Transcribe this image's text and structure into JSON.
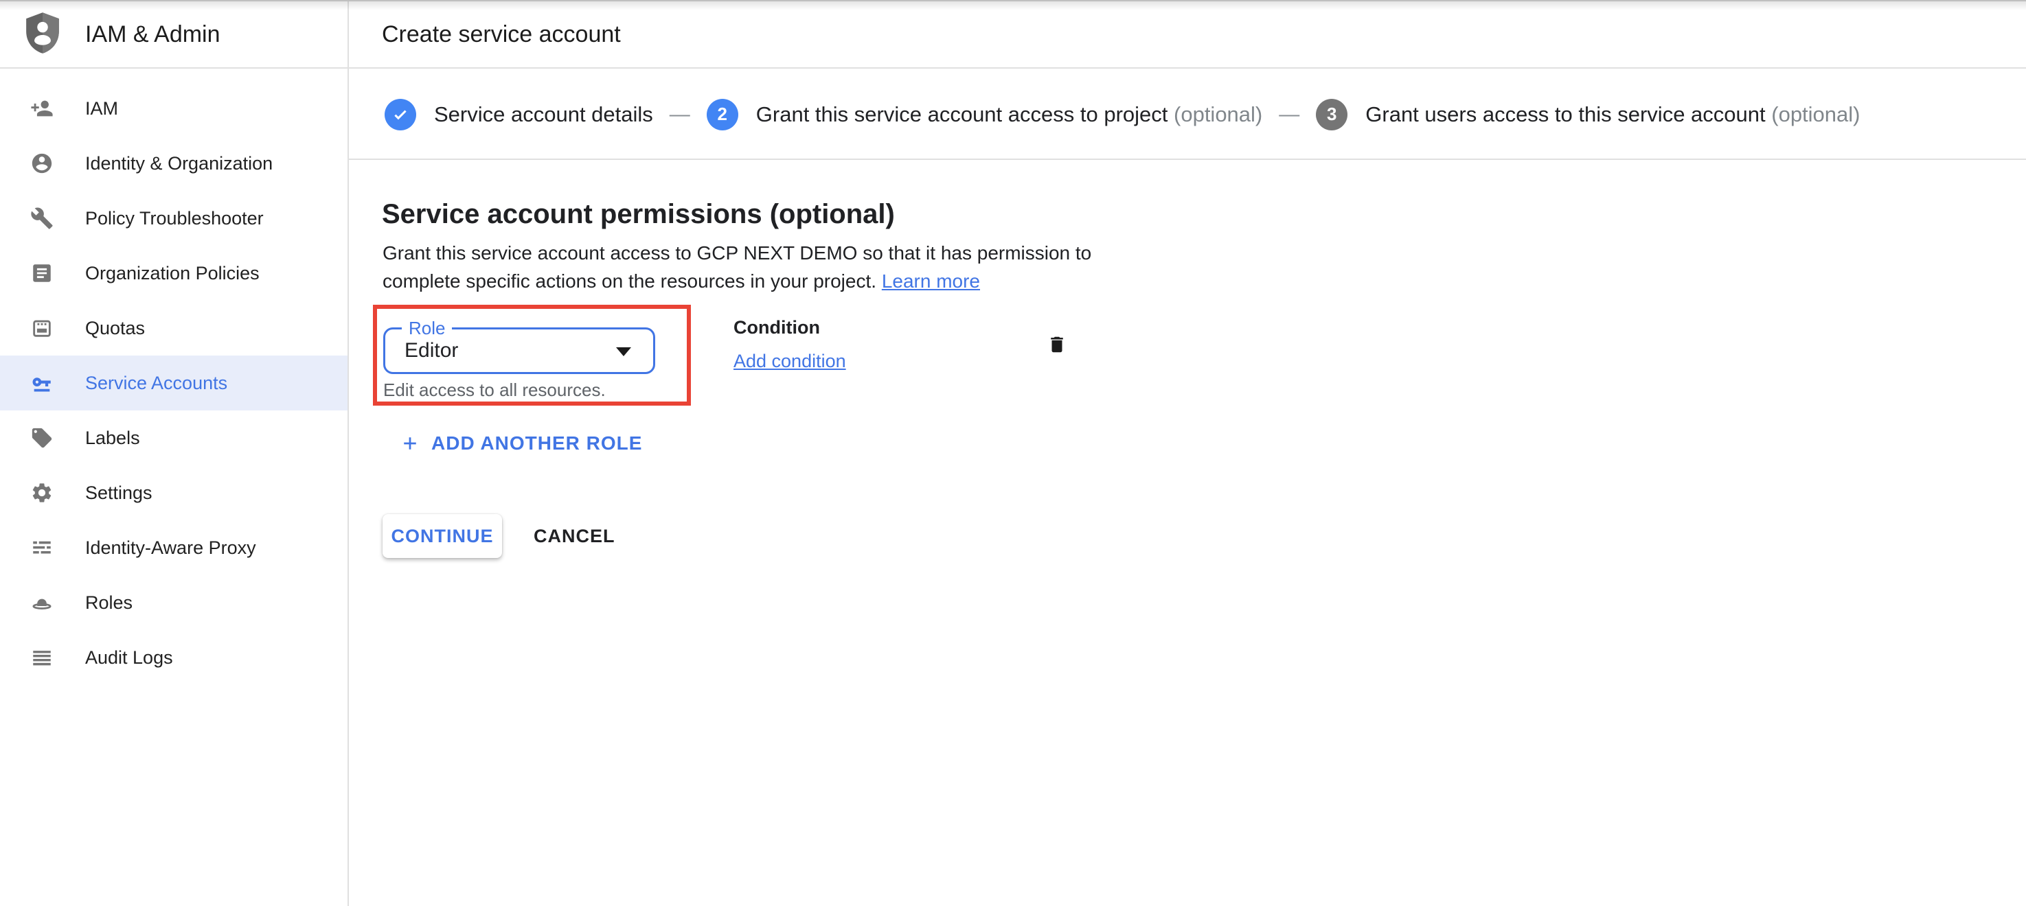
{
  "app": {
    "product_name": "IAM & Admin",
    "page_title": "Create service account"
  },
  "stepper": {
    "separator": "—",
    "steps": [
      {
        "label": "Service account details",
        "optional": "",
        "state": "done",
        "number": ""
      },
      {
        "label": "Grant this service account access to project",
        "optional": "(optional)",
        "state": "active",
        "number": "2"
      },
      {
        "label": "Grant users access to this service account",
        "optional": "(optional)",
        "state": "upcoming",
        "number": "3"
      }
    ]
  },
  "sidebar": {
    "items": [
      {
        "label": "IAM",
        "icon": "person-add-icon",
        "active": false
      },
      {
        "label": "Identity & Organization",
        "icon": "identity-person-icon",
        "active": false
      },
      {
        "label": "Policy Troubleshooter",
        "icon": "wrench-icon",
        "active": false
      },
      {
        "label": "Organization Policies",
        "icon": "document-icon",
        "active": false
      },
      {
        "label": "Quotas",
        "icon": "quotas-icon",
        "active": false
      },
      {
        "label": "Service Accounts",
        "icon": "key-icon",
        "active": true
      },
      {
        "label": "Labels",
        "icon": "tag-icon",
        "active": false
      },
      {
        "label": "Settings",
        "icon": "gear-icon",
        "active": false
      },
      {
        "label": "Identity-Aware Proxy",
        "icon": "iap-stripes-icon",
        "active": false
      },
      {
        "label": "Roles",
        "icon": "hat-icon",
        "active": false
      },
      {
        "label": "Audit Logs",
        "icon": "list-lines-icon",
        "active": false
      }
    ]
  },
  "content": {
    "heading": "Service account permissions (optional)",
    "description_line1": "Grant this service account access to GCP NEXT DEMO so that it has permission to",
    "description_line2": "complete specific actions on the resources in your project.",
    "learn_more_label": "Learn more",
    "role_field": {
      "label": "Role",
      "value": "Editor",
      "helper": "Edit access to all resources."
    },
    "condition": {
      "label": "Condition",
      "add_link_label": "Add condition"
    },
    "add_role_label": "ADD ANOTHER ROLE",
    "continue_label": "CONTINUE",
    "cancel_label": "CANCEL"
  },
  "icons": {
    "product": "shield-person-icon",
    "step_done": "check-icon",
    "delete": "trash-icon",
    "add": "plus-icon",
    "dropdown": "caret-down-icon"
  },
  "colors": {
    "accent_blue": "#4175e4",
    "step_blue": "#4285f4",
    "step_gray": "#757575",
    "annotation_red": "#e94335",
    "active_item_bg": "#e8edfa",
    "text_dark": "#202124",
    "text_gray": "#5f6368",
    "optional_gray": "#80868b",
    "border_gray": "#e0e0e0",
    "icon_gray": "#757575"
  }
}
